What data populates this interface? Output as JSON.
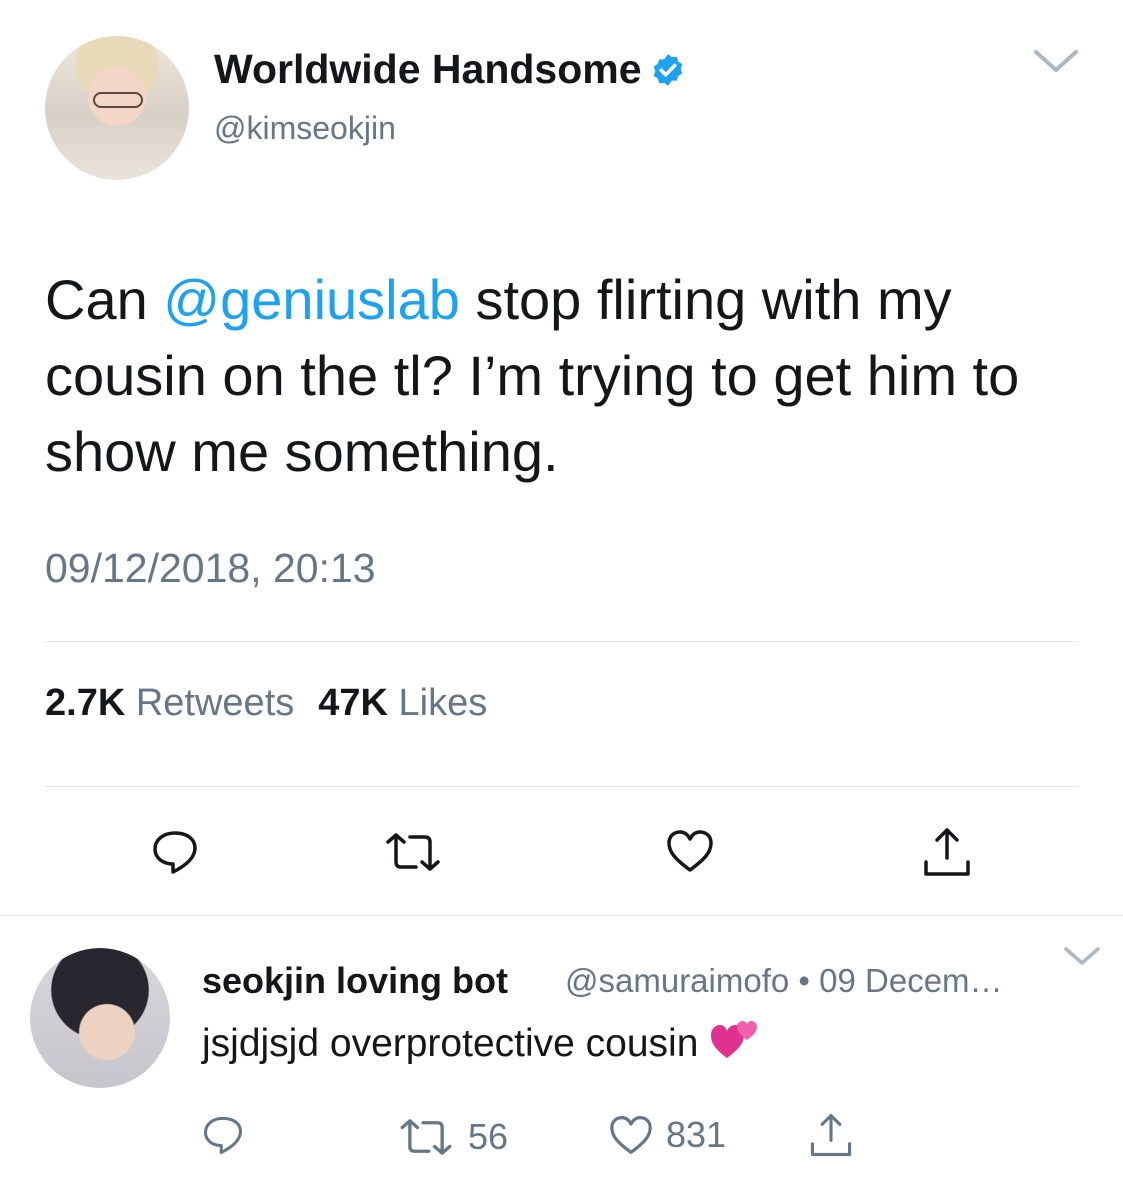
{
  "tweet": {
    "display_name": "Worldwide Handsome",
    "handle": "@kimseokjin",
    "text_pre": "Can ",
    "mention": "@geniuslab",
    "text_post": " stop flirting with my cousin on the tl? I’m trying to get him to show me something.",
    "timestamp": "09/12/2018, 20:13",
    "retweet_count": "2.7K",
    "retweet_label": "Retweets",
    "like_count": "47K",
    "like_label": "Likes"
  },
  "reply": {
    "display_name": "seokjin loving bot",
    "handle": "@samuraimofo",
    "separator": "•",
    "date": "09 Decem…",
    "text": "jsjdjsjd overprotective cousin",
    "emoji": "💞",
    "retweet_count": "56",
    "like_count": "831"
  },
  "icons": [
    "verified-badge-icon",
    "chevron-down-icon",
    "reply-icon",
    "retweet-icon",
    "like-icon",
    "share-icon",
    "two-hearts-emoji-icon"
  ],
  "colors": {
    "accent": "#1da1f2",
    "secondary_text": "#657786",
    "divider": "#e1e8ed"
  }
}
